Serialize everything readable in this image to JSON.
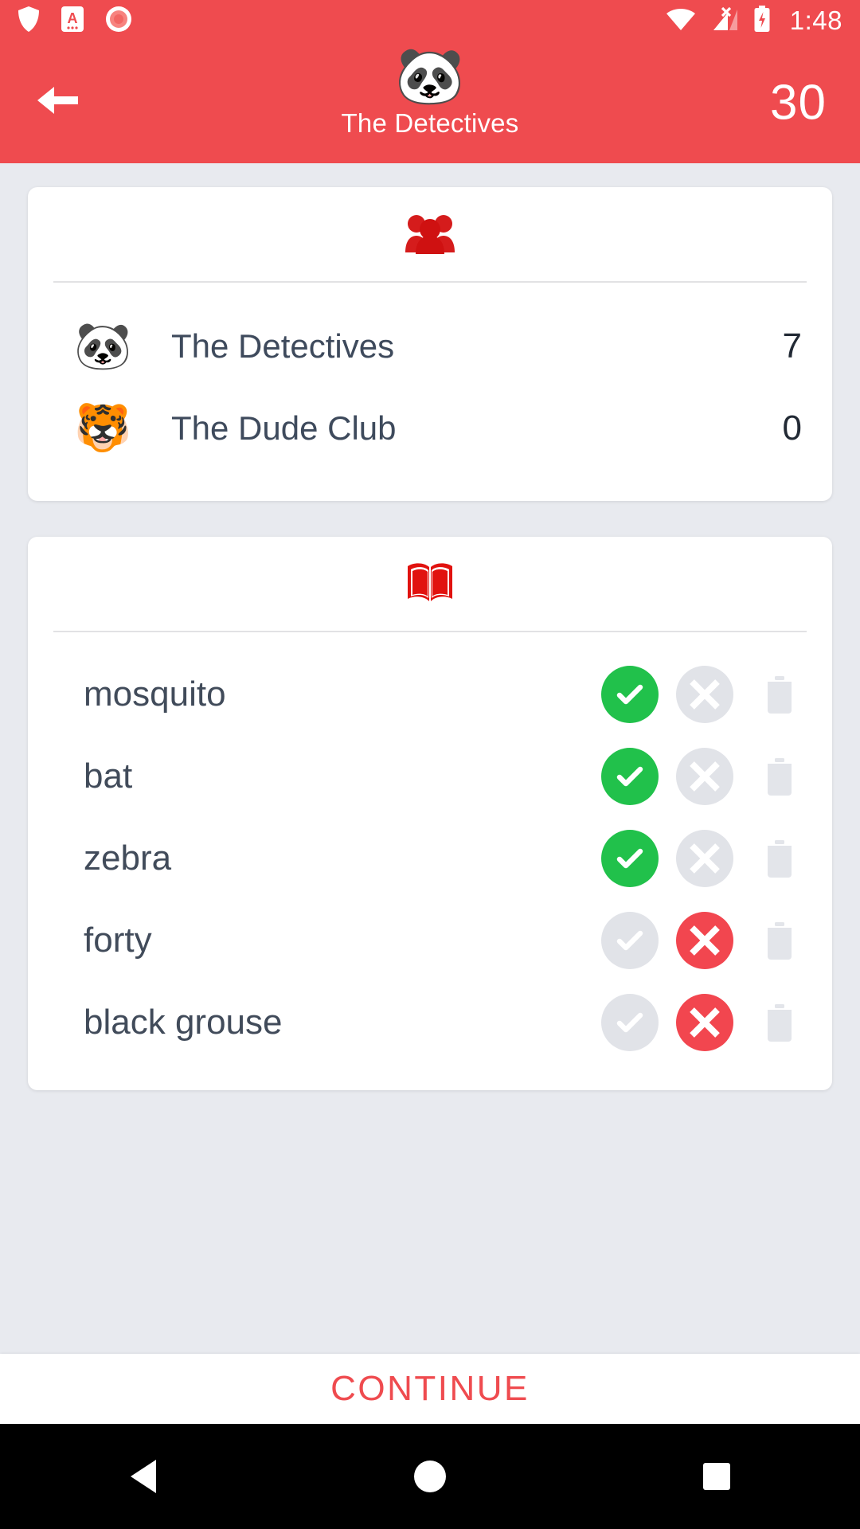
{
  "accent_color": "#ef4b4f",
  "status_bar": {
    "time": "1:48",
    "left_icons": [
      "shield-icon",
      "card-a-icon",
      "record-dot-icon"
    ],
    "right_icons": [
      "wifi-icon",
      "cellular-no-sim-icon",
      "battery-charging-icon"
    ]
  },
  "app_bar": {
    "back_label": "back-arrow",
    "team_avatar": "🐼",
    "title": "The Detectives",
    "timer": "30"
  },
  "scoreboard": {
    "header_icon": "people-group-icon",
    "teams": [
      {
        "avatar": "🐼",
        "name": "The Detectives",
        "score": "7"
      },
      {
        "avatar": "🐯",
        "name": "The Dude Club",
        "score": "0"
      }
    ]
  },
  "word_card": {
    "header_icon": "open-book-icon",
    "words": [
      {
        "label": "mosquito",
        "correct": true,
        "wrong": false,
        "deleted": false
      },
      {
        "label": "bat",
        "correct": true,
        "wrong": false,
        "deleted": false
      },
      {
        "label": "zebra",
        "correct": true,
        "wrong": false,
        "deleted": false
      },
      {
        "label": "forty",
        "correct": false,
        "wrong": true,
        "deleted": false
      },
      {
        "label": "black grouse",
        "correct": false,
        "wrong": true,
        "deleted": false
      }
    ]
  },
  "bottom": {
    "continue_label": "CONTINUE"
  },
  "nav_bar": {
    "back": "nav-back-icon",
    "home": "nav-home-icon",
    "recents": "nav-recents-icon"
  }
}
